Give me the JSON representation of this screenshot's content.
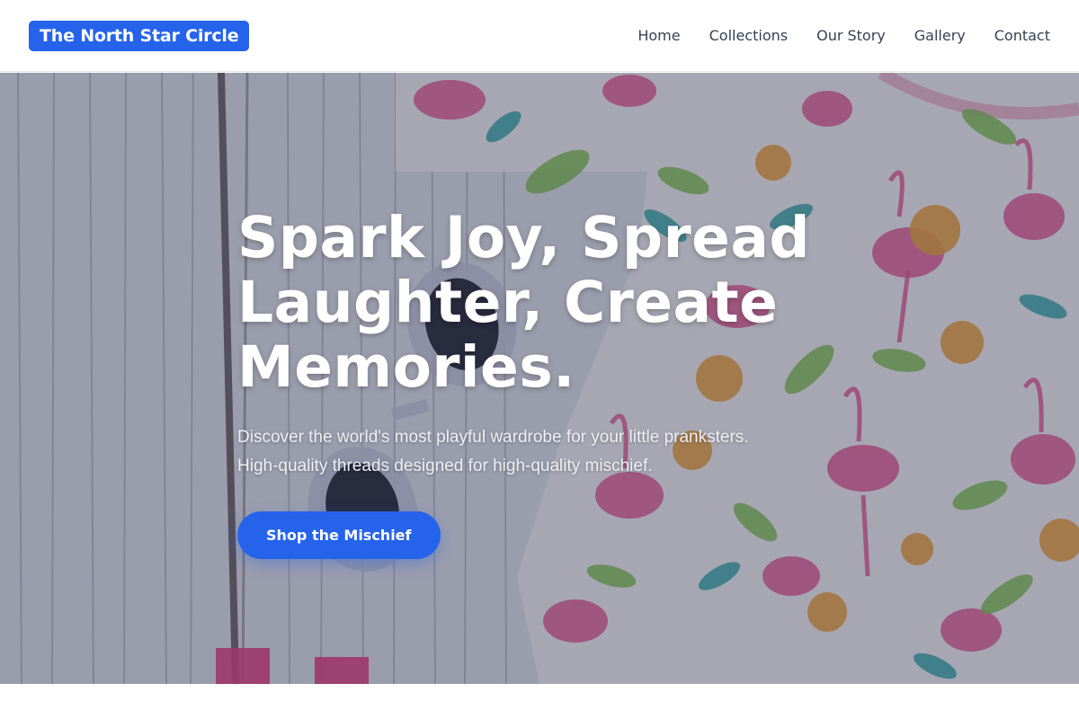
{
  "header": {
    "brand": "The North Star Circle",
    "nav": [
      {
        "label": "Home"
      },
      {
        "label": "Collections"
      },
      {
        "label": "Our Story"
      },
      {
        "label": "Gallery"
      },
      {
        "label": "Contact"
      }
    ]
  },
  "hero": {
    "title_lines": [
      "Spark Joy, Spread",
      "Laughter, Create",
      "Memories."
    ],
    "subtitle_lines": [
      "Discover the world's most playful wardrobe for your little pranksters.",
      "High-quality threads designed for high-quality mischief."
    ],
    "cta_label": "Shop the Mischief",
    "background_image": "flamingo-print-clothes-photo"
  },
  "colors": {
    "accent": "#2563eb",
    "nav_text": "#374151",
    "hero_text": "#ffffff"
  }
}
